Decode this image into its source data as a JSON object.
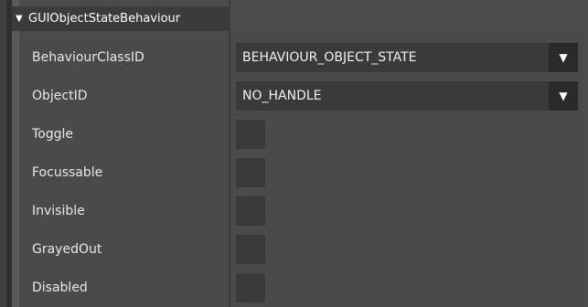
{
  "section": {
    "title": "GUIObjectStateBehaviour",
    "expanded_icon": "triangle-down-icon"
  },
  "fields": {
    "behaviour_class_id": {
      "label": "BehaviourClassID",
      "value": "BEHAVIOUR_OBJECT_STATE"
    },
    "object_id": {
      "label": "ObjectID",
      "value": "NO_HANDLE"
    },
    "toggle": {
      "label": "Toggle",
      "checked": false
    },
    "focussable": {
      "label": "Focussable",
      "checked": false
    },
    "invisible": {
      "label": "Invisible",
      "checked": false
    },
    "grayed_out": {
      "label": "GrayedOut",
      "checked": false
    },
    "disabled": {
      "label": "Disabled",
      "checked": false
    }
  },
  "dropdown_arrow_glyph": "▼",
  "section_toggle_glyph": "▼",
  "colors": {
    "background": "#4b4b4b",
    "control": "#3a3a3a",
    "dropdown_button": "#2a2a2a",
    "text": "#e8e8e8"
  }
}
